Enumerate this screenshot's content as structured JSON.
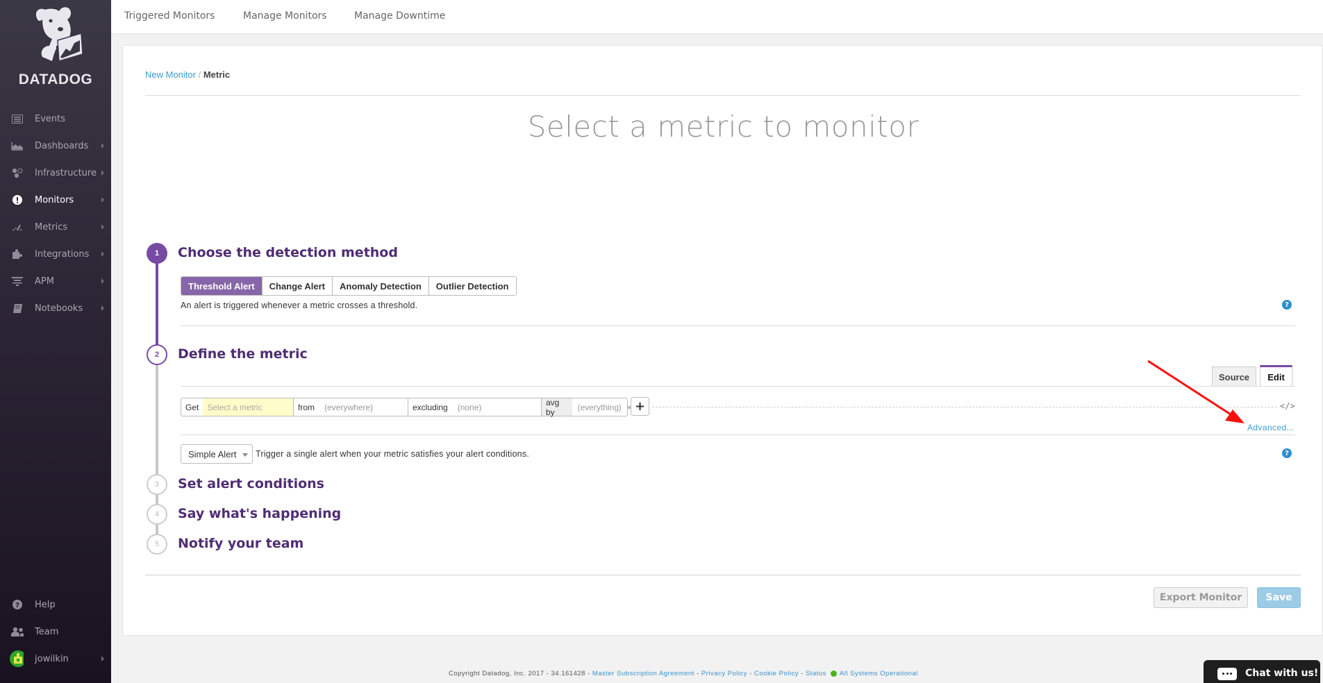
{
  "brand": {
    "name": "DATADOG"
  },
  "sidebar": {
    "items": [
      {
        "label": "Events",
        "icon": "list-icon",
        "has_submenu": false,
        "active": false
      },
      {
        "label": "Dashboards",
        "icon": "area-chart-icon",
        "has_submenu": true,
        "active": false
      },
      {
        "label": "Infrastructure",
        "icon": "hexagon-nodes-icon",
        "has_submenu": true,
        "active": false
      },
      {
        "label": "Monitors",
        "icon": "exclamation-circle-icon",
        "has_submenu": true,
        "active": true
      },
      {
        "label": "Metrics",
        "icon": "gauge-icon",
        "has_submenu": true,
        "active": false
      },
      {
        "label": "Integrations",
        "icon": "puzzle-icon",
        "has_submenu": true,
        "active": false
      },
      {
        "label": "APM",
        "icon": "filter-lines-icon",
        "has_submenu": true,
        "active": false
      },
      {
        "label": "Notebooks",
        "icon": "book-icon",
        "has_submenu": true,
        "active": false
      }
    ],
    "bottom": [
      {
        "label": "Help",
        "icon": "question-circle-icon"
      },
      {
        "label": "Team",
        "icon": "users-icon"
      },
      {
        "label": "jowilkin",
        "icon": "avatar"
      }
    ]
  },
  "topnav": {
    "links": [
      "Triggered Monitors",
      "Manage Monitors",
      "Manage Downtime"
    ]
  },
  "breadcrumb": {
    "parent": "New Monitor",
    "separator": "/",
    "current": "Metric"
  },
  "page_title": "Select a metric to monitor",
  "steps": [
    {
      "number": "1",
      "title": "Choose the detection method",
      "state": "done"
    },
    {
      "number": "2",
      "title": "Define the metric",
      "state": "current"
    },
    {
      "number": "3",
      "title": "Set alert conditions",
      "state": "todo"
    },
    {
      "number": "4",
      "title": "Say what's happening",
      "state": "todo"
    },
    {
      "number": "5",
      "title": "Notify your team",
      "state": "todo"
    }
  ],
  "detection": {
    "options": [
      "Threshold Alert",
      "Change Alert",
      "Anomaly Detection",
      "Outlier Detection"
    ],
    "selected": "Threshold Alert",
    "description": "An alert is triggered whenever a metric crosses a threshold."
  },
  "metric_editor": {
    "tabs": [
      "Source",
      "Edit"
    ],
    "active_tab": "Edit",
    "query": {
      "get_label": "Get",
      "metric_placeholder": "Select a metric",
      "from_label": "from",
      "from_value": "(everywhere)",
      "excluding_label": "excluding",
      "excluding_value": "(none)",
      "avg_by_label": "avg by",
      "avg_by_value": "(everything)"
    },
    "add_label": "+",
    "code_toggle": "</>",
    "advanced_link": "Advanced..."
  },
  "alert_type": {
    "selected": "Simple Alert",
    "description": "Trigger a single alert when your metric satisfies your alert conditions."
  },
  "actions": {
    "export": "Export Monitor",
    "save": "Save"
  },
  "footer": {
    "copyright": "Copyright Datadog, Inc. 2017 - 34.161428 -",
    "links": [
      "Master Subscription Agreement",
      "Privacy Policy",
      "Cookie Policy",
      "Status"
    ],
    "separator": "-",
    "status_text": "All Systems Operational",
    "status_color": "#4ab418"
  },
  "chat": {
    "label": "Chat with us!"
  },
  "colors": {
    "accent": "#774aa4",
    "link": "#3a9bd1",
    "annotation_arrow": "#ff0000"
  }
}
